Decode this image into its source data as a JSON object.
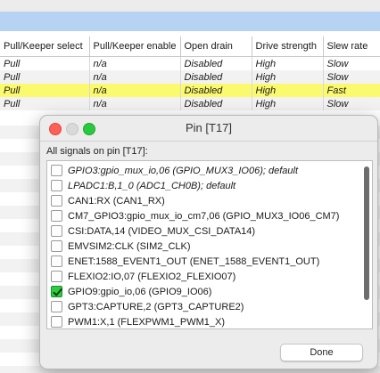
{
  "table": {
    "columns": [
      "Pull/Keeper select",
      "Pull/Keeper enable",
      "Open drain",
      "Drive strength",
      "Slew rate"
    ],
    "rows": [
      [
        "Pull",
        "n/a",
        "Disabled",
        "High",
        "Slow"
      ],
      [
        "Pull",
        "n/a",
        "Disabled",
        "High",
        "Slow"
      ],
      [
        "Pull",
        "n/a",
        "Disabled",
        "High",
        "Fast"
      ],
      [
        "Pull",
        "n/a",
        "Disabled",
        "High",
        "Slow"
      ]
    ],
    "highlight_color": "#fbfa6e"
  },
  "dialog": {
    "title": "Pin [T17]",
    "caption": "All signals on pin [T17]:",
    "signals": [
      {
        "label": "GPIO3:gpio_mux_io,06 (GPIO_MUX3_IO06); default",
        "checked": false,
        "italic": true
      },
      {
        "label": "LPADC1:B,1_0 (ADC1_CH0B); default",
        "checked": false,
        "italic": true
      },
      {
        "label": "CAN1:RX (CAN1_RX)",
        "checked": false,
        "italic": false
      },
      {
        "label": "CM7_GPIO3:gpio_mux_io_cm7,06 (GPIO_MUX3_IO06_CM7)",
        "checked": false,
        "italic": false
      },
      {
        "label": "CSI:DATA,14 (VIDEO_MUX_CSI_DATA14)",
        "checked": false,
        "italic": false
      },
      {
        "label": "EMVSIM2:CLK (SIM2_CLK)",
        "checked": false,
        "italic": false
      },
      {
        "label": "ENET:1588_EVENT1_OUT (ENET_1588_EVENT1_OUT)",
        "checked": false,
        "italic": false
      },
      {
        "label": "FLEXIO2:IO,07 (FLEXIO2_FLEXIO07)",
        "checked": false,
        "italic": false
      },
      {
        "label": "GPIO9:gpio_io,06 (GPIO9_IO06)",
        "checked": true,
        "italic": false
      },
      {
        "label": "GPT3:CAPTURE,2 (GPT3_CAPTURE2)",
        "checked": false,
        "italic": false
      },
      {
        "label": "PWM1:X,1 (FLEXPWM1_PWM1_X)",
        "checked": false,
        "italic": false
      }
    ],
    "done_label": "Done",
    "icons": {
      "close": "close-icon",
      "minimize": "minimize-icon",
      "zoom": "zoom-icon",
      "check": "checkmark-icon"
    }
  },
  "colors": {
    "accent_bar": "#b7d3f3",
    "check_green": "#2ecc40",
    "traffic_red": "#fe5f57",
    "traffic_green": "#28c840"
  }
}
